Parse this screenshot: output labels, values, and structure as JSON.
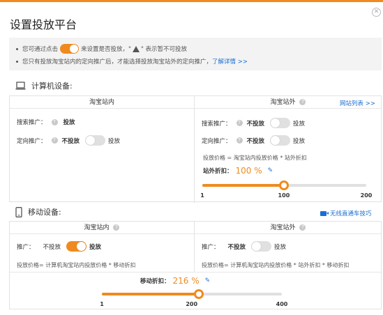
{
  "dialog": {
    "title": "设置投放平台",
    "close_glyph": "✕"
  },
  "notice": {
    "line1_prefix": "您可通过点击",
    "line1_middle": "来设置是否投放，\"",
    "line1_suffix": "\" 表示暂不可投放",
    "line2_text": "您只有投放淘宝站内的定向推广后，才能选择投放淘宝站外的定向推广，",
    "line2_link": "了解详情 >>"
  },
  "computer": {
    "section_label": "计算机设备:",
    "inside": {
      "header": "淘宝站内",
      "search_label": "搜索推广：",
      "search_state": "投放",
      "targeted_label": "定向推广：",
      "targeted_off_label": "不投放",
      "targeted_on_label": "投放",
      "targeted_enabled": false
    },
    "outside": {
      "header": "淘宝站外",
      "site_list_link": "网站列表 >>",
      "search_label": "搜索推广：",
      "search_off_label": "不投放",
      "search_on_label": "投放",
      "search_enabled": false,
      "targeted_label": "定向推广：",
      "targeted_off_label": "不投放",
      "targeted_on_label": "投放",
      "targeted_enabled": false,
      "formula": "投放价格 = 淘宝站内投放价格 * 站外折扣",
      "discount_label": "站外折扣：",
      "discount_value": "100 %",
      "slider": {
        "min": 1,
        "max": 200,
        "value": 100,
        "ticks": [
          "1",
          "100",
          "200"
        ]
      }
    }
  },
  "mobile": {
    "section_label": "移动设备:",
    "video_link": "无线直通车技巧",
    "inside": {
      "header": "淘宝站内",
      "promo_label": "推广：",
      "off_label": "不投放",
      "on_label": "投放",
      "enabled": true,
      "formula": "投放价格= 计算机淘宝站内投放价格 * 移动折扣"
    },
    "outside": {
      "header": "淘宝站外",
      "promo_label": "推广：",
      "off_label": "不投放",
      "on_label": "投放",
      "enabled": false,
      "formula": "投放价格= 计算机淘宝站内投放价格 * 站外折扣 * 移动折扣"
    },
    "discount_label": "移动折扣：",
    "discount_value": "216 %",
    "slider": {
      "min": 1,
      "max": 400,
      "value": 216,
      "ticks": [
        "1",
        "200",
        "400"
      ]
    }
  },
  "colors": {
    "accent": "#f08a1e",
    "link": "#1a6fd3"
  },
  "icons": {
    "help": "?",
    "pencil": "✎"
  }
}
